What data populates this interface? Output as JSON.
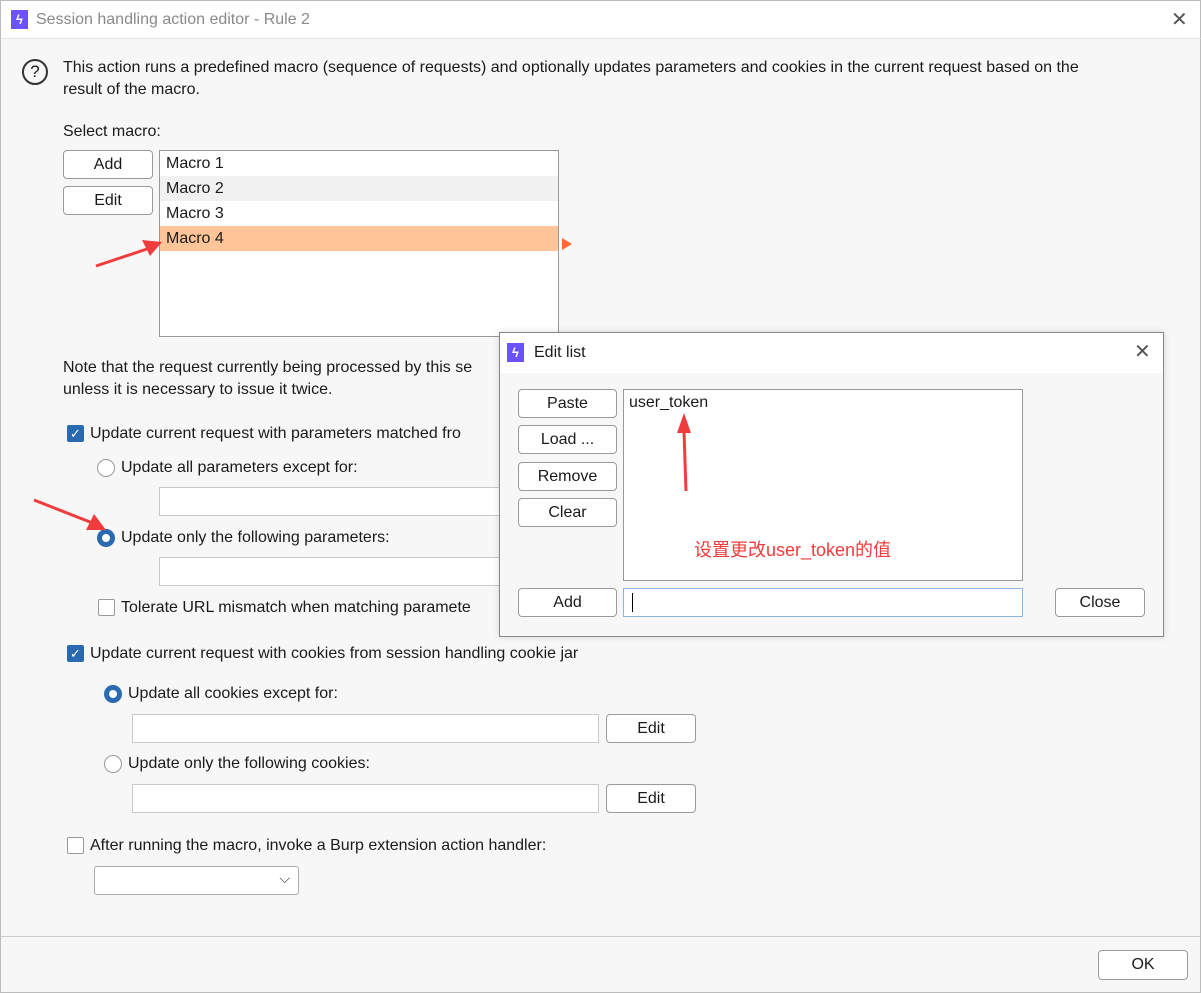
{
  "window": {
    "title": "Session handling action editor - Rule 2",
    "icon": "burp-lightning-icon",
    "close": "✕"
  },
  "intro": {
    "line1": "This action runs a predefined macro (sequence of requests) and optionally updates parameters and cookies in the current request based on the",
    "line2": "result of the macro."
  },
  "macro": {
    "label": "Select macro:",
    "add": "Add",
    "edit": "Edit",
    "items": [
      "Macro 1",
      "Macro 2",
      "Macro 3",
      "Macro 4"
    ],
    "selected": "Macro 4"
  },
  "note": {
    "line1": "Note that the request currently being processed by this se",
    "line2": "unless it is necessary to issue it twice."
  },
  "params": {
    "checkbox": "Update current request with parameters matched fro",
    "checked": true,
    "radio_all": "Update all parameters except for:",
    "radio_only": "Update only the following parameters:",
    "selected": "only",
    "tolerate": "Tolerate URL mismatch when matching paramete",
    "tolerate_checked": false
  },
  "cookies": {
    "checkbox": "Update current request with cookies from session handling cookie jar",
    "checked": true,
    "radio_all": "Update all cookies except for:",
    "radio_only": "Update only the following cookies:",
    "selected": "all",
    "edit1": "Edit",
    "edit2": "Edit"
  },
  "extension": {
    "checkbox": "After running the macro, invoke a Burp extension action handler:",
    "checked": false,
    "select_value": ""
  },
  "footer": {
    "ok": "OK"
  },
  "edit_list": {
    "title": "Edit list",
    "paste": "Paste",
    "load": "Load ...",
    "remove": "Remove",
    "clear": "Clear",
    "add": "Add",
    "close": "Close",
    "items": [
      "user_token"
    ],
    "input_value": "",
    "annotation": "设置更改user_token的值"
  },
  "colors": {
    "selection": "#ffc497",
    "accent": "#2a6ab0",
    "annotation": "#f03c3c",
    "brand": "#6b52ff"
  }
}
